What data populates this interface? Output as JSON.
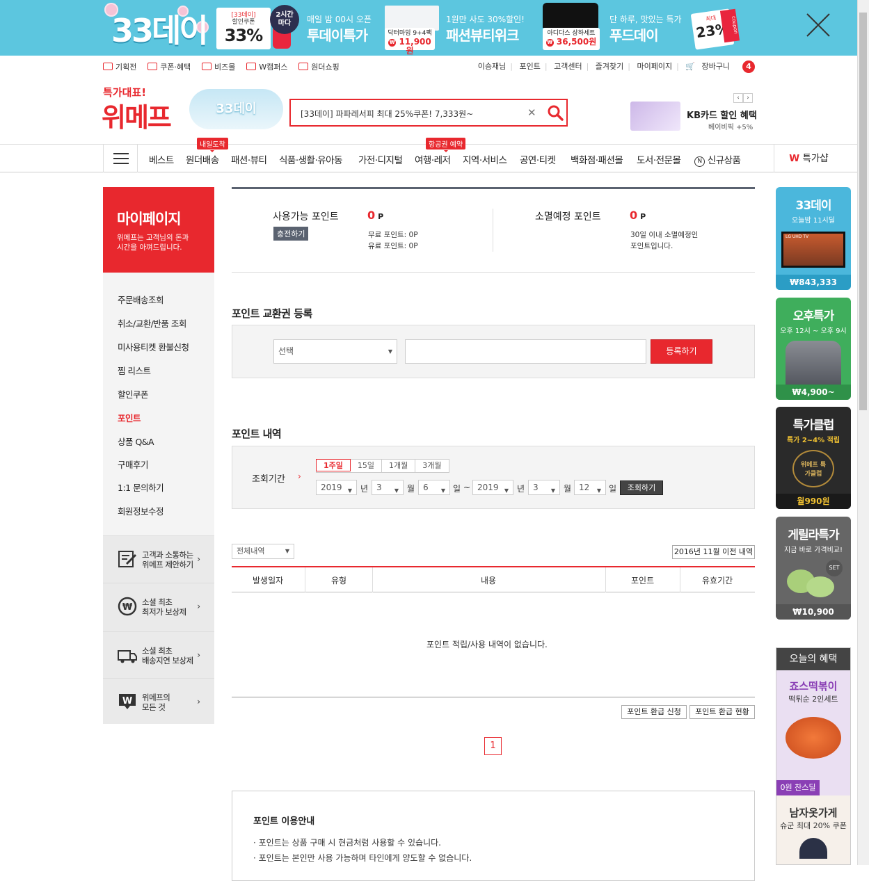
{
  "banner": {
    "logo": "33데이",
    "coupon": {
      "line1": "[33데이]",
      "line2": "할인쿠폰",
      "pct": "33%"
    },
    "badge_2h": {
      "line1": "2시간",
      "line2": "마다"
    },
    "today": {
      "sub": "매일 밤 00시 오픈",
      "title": "투데이특가",
      "product": "닥터마밍 9+4팩",
      "price": "11,900원"
    },
    "fashion": {
      "sub": "1원만 사도 30%할인!",
      "title": "패션뷰티위크",
      "product": "아디다스 상하세트",
      "price": "36,500원"
    },
    "food": {
      "sub": "단 하루, 맛있는 특가",
      "title": "푸드데이",
      "max": "최대",
      "pct": "23%",
      "ribbon": "coupon"
    },
    "close_icon": "close-icon"
  },
  "util": {
    "left": [
      "기획전",
      "쿠폰·혜택",
      "비즈몰",
      "W캠퍼스",
      "원더쇼핑"
    ],
    "right": [
      "이승재님",
      "포인트",
      "고객센터",
      "즐겨찾기",
      "마이페이지"
    ],
    "cart": "장바구니",
    "cart_count": "4"
  },
  "header": {
    "logo_small": "특가대표!",
    "logo_big": "위메프",
    "promo": "33데이",
    "search_value": "[33데이] 파파레서피 최대 25%쿠폰! 7,333원~",
    "kb_title": "KB카드 할인 혜택",
    "kb_sub": "베이비픽 +5%",
    "arrow_prev": "‹",
    "arrow_next": "›"
  },
  "nav": {
    "items": [
      "베스트",
      "원더배송",
      "패션·뷰티",
      "식품·생활·유아동",
      "가전·디지털",
      "여행·레저",
      "지역·서비스",
      "공연·티켓",
      "백화점·패션몰",
      "도서·전문몰",
      "신규상품"
    ],
    "tag_wonder": "내일도착",
    "tag_travel": "항공권 예약",
    "special": "특가샵"
  },
  "sidebar": {
    "title": "마이페이지",
    "subtitle_1": "위메프는 고객님의 돈과",
    "subtitle_2": "시간을 아껴드립니다.",
    "menu": [
      "주문배송조회",
      "취소/교환/반품 조회",
      "미사용티켓 환불신청",
      "찜 리스트",
      "할인쿠폰",
      "포인트",
      "상품 Q&A",
      "구매후기",
      "1:1 문의하기",
      "회원정보수정"
    ],
    "boxes": [
      {
        "l1": "고객과 소통하는",
        "l2": "위메프 제안하기"
      },
      {
        "l1": "소셜 최초",
        "l2": "최저가 보상제"
      },
      {
        "l1": "소셜 최초",
        "l2": "배송지연 보상제"
      },
      {
        "l1": "위메프의",
        "l2": "모든 것"
      }
    ]
  },
  "points": {
    "available_label": "사용가능 포인트",
    "available_value": "0",
    "unit": "P",
    "charge": "충전하기",
    "free": "무료 포인트: 0P",
    "paid": "유료 포인트: 0P",
    "expire_label": "소멸예정 포인트",
    "expire_value": "0",
    "expire_note_1": "30일 이내 소멸예정인",
    "expire_note_2": "포인트입니다."
  },
  "voucher": {
    "title": "포인트 교환권 등록",
    "select": "선택",
    "button": "등록하기"
  },
  "history": {
    "title": "포인트 내역",
    "period_label": "조회기간",
    "tabs": [
      "1주일",
      "15일",
      "1개월",
      "3개월"
    ],
    "from": {
      "year": "2019",
      "month": "3",
      "day": "6"
    },
    "to": {
      "year": "2019",
      "month": "3",
      "day": "12"
    },
    "u_year": "년",
    "u_month": "월",
    "u_day": "일",
    "tilde": "~",
    "search": "조회하기",
    "filter": "전체내역",
    "old_btn": "2016년 11월 이전 내역",
    "columns": [
      "발생일자",
      "유형",
      "내용",
      "포인트",
      "유효기간"
    ],
    "empty": "포인트 적립/사용 내역이 없습니다.",
    "refund_apply": "포인트 환급 신청",
    "refund_status": "포인트 환급 현황",
    "page": "1"
  },
  "guide": {
    "title": "포인트 이용안내",
    "lines": [
      "· 포인트는 상품 구매 시 현금처럼 사용할 수 있습니다.",
      "· 포인트는 본인만 사용 가능하며 타인에게 양도할 수 없습니다."
    ]
  },
  "right": {
    "cards": [
      {
        "title": "33데이",
        "sub": "오늘밤 11시딜",
        "tv": "LG UHD TV",
        "price": "843,333"
      },
      {
        "title": "오후특가",
        "sub": "오후 12시 ~ 오후 9시",
        "price": "4,900~"
      },
      {
        "title": "특가클럽",
        "sub": "특가 2~4% 적립",
        "emblem": "위메프 특가클럽",
        "price": "월990원"
      },
      {
        "title": "게릴라특가",
        "sub": "지금 바로 가격비교!",
        "set": "SET",
        "price": "10,900"
      }
    ],
    "benefit_title": "오늘의 혜택",
    "b1_title": "죠스떡볶이",
    "b1_sub": "떡튀순 2인세트",
    "b1_price": "0원 찬스딜",
    "b2_title": "남자옷가게",
    "b2_sub": "슈군 최대 20% 쿠폰"
  },
  "colors": {
    "accent": "#e8282e",
    "banner": "#5cc6df",
    "dark": "#5a6270"
  }
}
